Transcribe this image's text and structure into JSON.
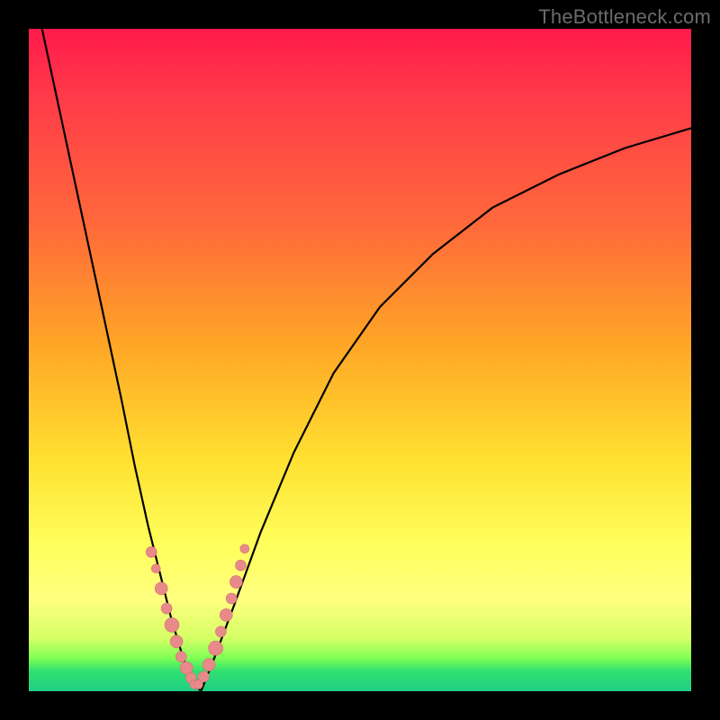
{
  "watermark": "TheBottleneck.com",
  "chart_data": {
    "type": "line",
    "title": "",
    "xlabel": "",
    "ylabel": "",
    "xlim": [
      0,
      100
    ],
    "ylim": [
      0,
      100
    ],
    "grid": false,
    "legend": false,
    "series": [
      {
        "name": "left-branch",
        "x": [
          2,
          5,
          8,
          11,
          14,
          16,
          18,
          20,
          21.5,
          23,
          24,
          25,
          26
        ],
        "y": [
          100,
          86,
          72,
          58,
          44,
          34,
          25,
          17,
          11,
          6,
          3,
          1,
          0
        ]
      },
      {
        "name": "right-branch",
        "x": [
          26,
          28,
          31,
          35,
          40,
          46,
          53,
          61,
          70,
          80,
          90,
          100
        ],
        "y": [
          0,
          5,
          13,
          24,
          36,
          48,
          58,
          66,
          73,
          78,
          82,
          85
        ]
      }
    ],
    "points": {
      "name": "markers",
      "x": [
        18.5,
        19.2,
        20.0,
        20.8,
        21.6,
        22.3,
        23.0,
        23.8,
        24.5,
        25.0,
        25.6,
        26.4,
        27.2,
        28.2,
        29.0,
        29.8,
        30.6,
        31.3,
        32.0,
        32.6
      ],
      "y": [
        21,
        18.5,
        15.5,
        12.5,
        10,
        7.5,
        5.2,
        3.5,
        2.0,
        1.0,
        1.0,
        2.2,
        4.0,
        6.5,
        9.0,
        11.5,
        14.0,
        16.5,
        19.0,
        21.5
      ],
      "r": [
        6,
        5,
        7,
        6,
        8,
        7,
        6,
        7,
        6,
        5,
        5,
        6,
        7,
        8,
        6,
        7,
        6,
        7,
        6,
        5
      ]
    },
    "background_gradient": {
      "top": "#ff1a4b",
      "mid": "#ffe030",
      "bottom": "#1ecf84"
    }
  }
}
